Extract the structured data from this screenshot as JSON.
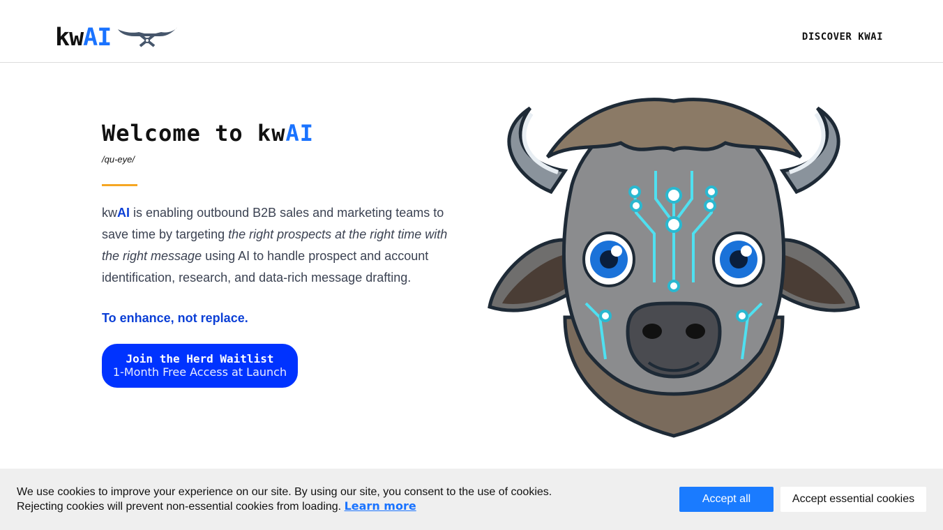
{
  "header": {
    "logo_prefix": "kw",
    "logo_accent": "AI",
    "nav_link": "DISCOVER KWAI"
  },
  "hero": {
    "title_prefix": "Welcome to kw",
    "title_accent": "AI",
    "pronunciation": "/qu-eye/",
    "desc_brand_prefix": "kw",
    "desc_brand_accent": "AI",
    "desc_part1": " is enabling outbound B2B sales and marketing teams to save time by targeting ",
    "desc_italic": "the right prospects at the right time with the right message",
    "desc_part2": " using AI to handle prospect and account identification, research, and data-rich message drafting.",
    "tagline": "To enhance, not replace.",
    "cta_line1": "Join the Herd Waitlist",
    "cta_line2": "1-Month Free Access at Launch"
  },
  "cookie": {
    "line1": "We use cookies to improve your experience on our site. By using our site, you consent to the use of cookies.",
    "line2": "Rejecting cookies will prevent non-essential cookies from loading. ",
    "learn_more": "Learn more",
    "accept_all": "Accept all",
    "accept_essential": "Accept essential cookies"
  },
  "icons": {
    "logo_mark": "bull-horns-icon",
    "mascot": "cyber-buffalo-mascot"
  },
  "colors": {
    "accent": "#1a73ff",
    "brand_blue": "#0b3fd6",
    "cta_blue": "#0033ff",
    "divider": "#f5a623",
    "cookie_bg": "#efefef"
  }
}
